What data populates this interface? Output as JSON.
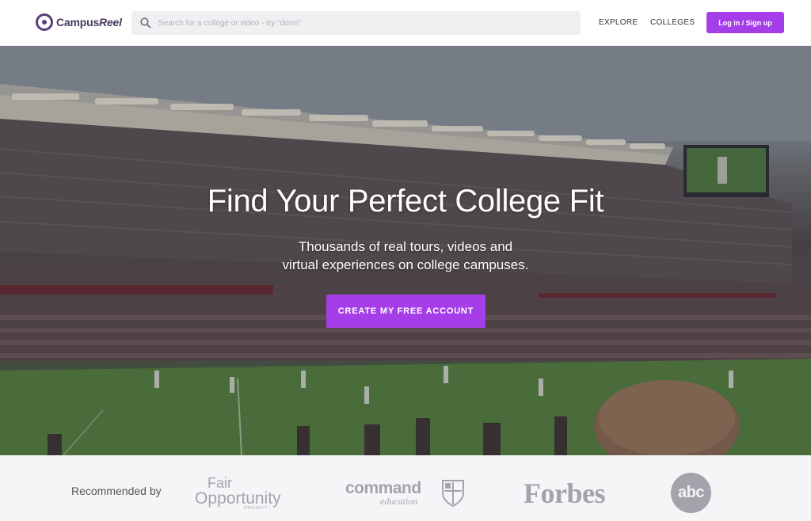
{
  "header": {
    "logo_main": "Campus",
    "logo_accent": "Reel",
    "search_placeholder": "Search for a college or video - try \"dorm\"",
    "nav": {
      "explore": "EXPLORE",
      "colleges": "COLLEGES"
    },
    "login_label": "Log in / Sign up"
  },
  "hero": {
    "title": "Find Your Perfect College Fit",
    "subtitle_line1": "Thousands of real tours, videos and",
    "subtitle_line2": "virtual experiences on college campuses.",
    "cta_label": "CREATE MY FREE ACCOUNT"
  },
  "recommended": {
    "label": "Recommended by",
    "partners": {
      "fair_opportunity": {
        "line1": "Fair",
        "line2": "Opportunity",
        "line3": "PROJECT"
      },
      "command_education": {
        "line1": "command",
        "line2": "education"
      },
      "forbes": "Forbes",
      "abc": "abc"
    }
  },
  "colors": {
    "accent": "#a53ee8",
    "logo": "#5a3d7a",
    "partner_gray": "#a3a3ab",
    "footer_bg": "#f5f5f8"
  },
  "icons": {
    "logo": "camera-lens-icon",
    "search": "search-icon"
  }
}
